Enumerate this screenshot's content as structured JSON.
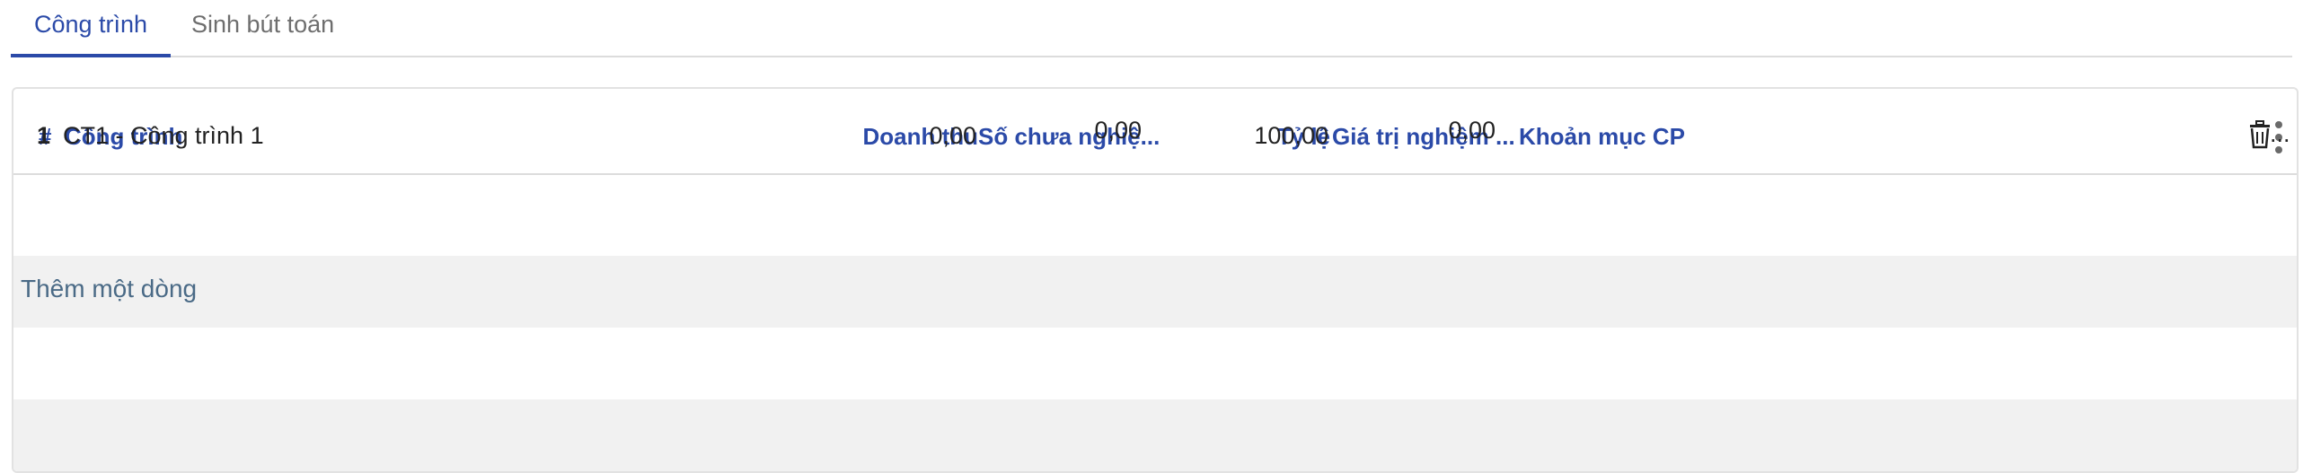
{
  "tabs": [
    {
      "label": "Công trình",
      "active": true
    },
    {
      "label": "Sinh bút toán",
      "active": false
    }
  ],
  "grid": {
    "columns": {
      "num": "#",
      "project": "Công trình",
      "revenue": "Doanh thu",
      "unaccepted": "Số chưa nghiệ...",
      "rate": "Tỷ lệ",
      "accepted_value": "Giá trị nghiệm ...",
      "cost_item": "Khoản mục CP"
    },
    "rows": [
      {
        "num": "1",
        "project": "CT1 - Công trình 1",
        "revenue": "0,00",
        "unaccepted": "0,00",
        "rate": "100,00",
        "accepted_value": "0,00",
        "cost_item": "",
        "row_action_overflow": "..."
      }
    ],
    "add_line_label": "Thêm một dòng"
  },
  "colors": {
    "accent": "#2b4aa8",
    "link": "#4a6a86",
    "band": "#f1f1f1"
  },
  "icons": {
    "row_delete": "trash-icon",
    "column_options": "kebab-menu-icon"
  }
}
